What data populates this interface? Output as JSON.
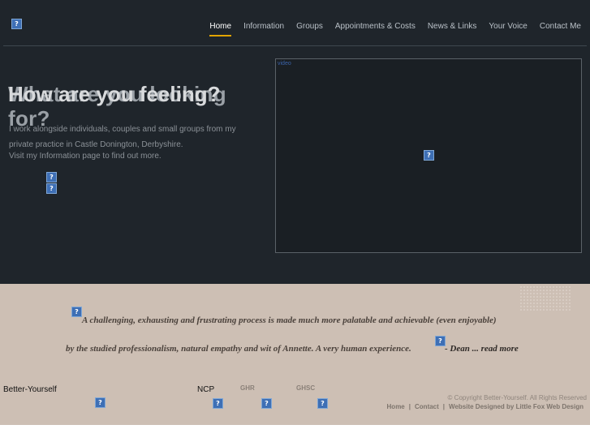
{
  "nav": {
    "items": [
      "Home",
      "Information",
      "Groups",
      "Appointments & Costs",
      "News & Links",
      "Your Voice",
      "Contact Me"
    ],
    "active": "Home"
  },
  "hero": {
    "headline_back": "What are you looking for?",
    "headline_front": "How are you feeling?",
    "intro_line1": "I work alongside individuals, couples and small groups from my",
    "intro_line2": "private practice in Castle Donington, Derbyshire.",
    "intro_line3": "Visit my Information page to find out more.",
    "video_label": "video"
  },
  "testimonial": {
    "line1": "A challenging, exhausting and frustrating process is made much more palatable and achievable (even enjoyable)",
    "line2": "by the studied professionalism, natural empathy and wit of Annette. A very human experience.",
    "author": "- Dean ... read more"
  },
  "footer": {
    "brand": "Better-Yourself",
    "ncp": "NCP",
    "ghr": "GHR",
    "ghsc": "GHSC",
    "copyright": "© Copyright Better-Yourself. All Rights Reserved",
    "links": [
      "Home",
      "Contact",
      "Website Designed by Little Fox Web Design"
    ]
  },
  "colors": {
    "hero_bg": "#1f252b",
    "band_bg": "#cdbfb4",
    "accent": "#e2a400"
  },
  "icons": {
    "broken_image": "broken-image-icon"
  }
}
